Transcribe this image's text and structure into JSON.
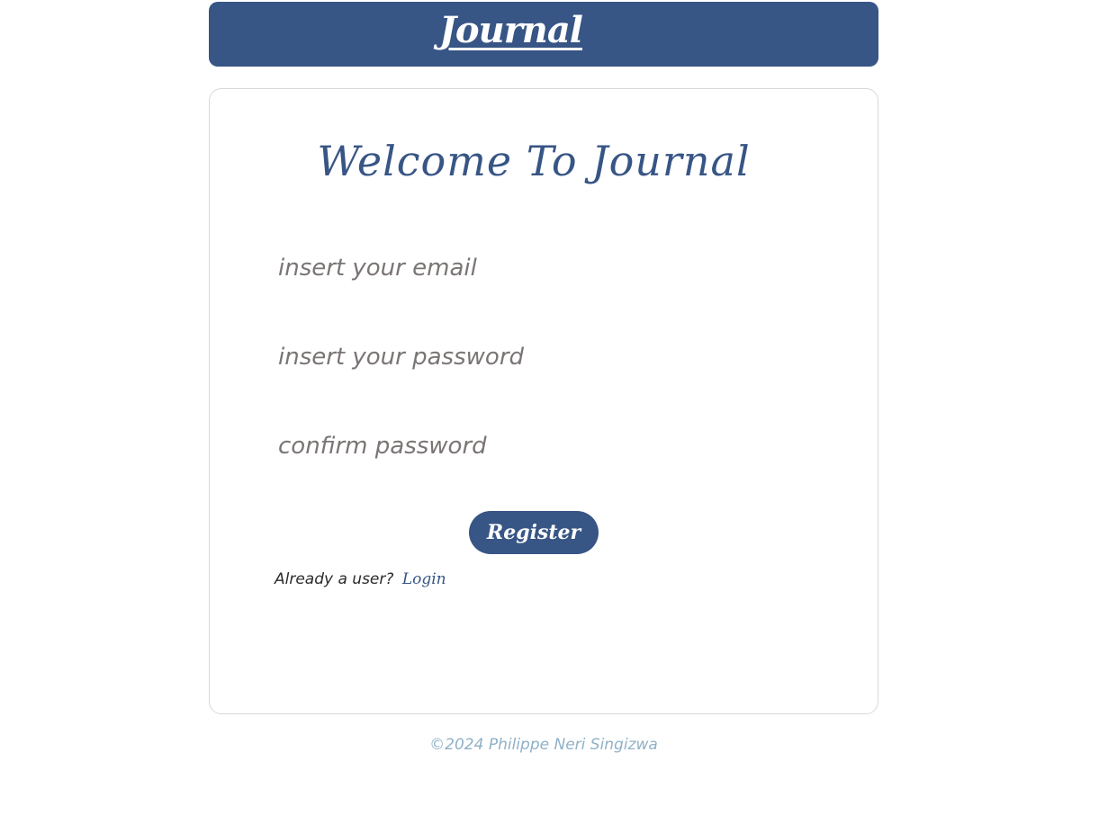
{
  "header": {
    "brand": "Journal"
  },
  "form": {
    "title": "Welcome To Journal",
    "email_placeholder": "insert your email",
    "password_placeholder": "insert your password",
    "confirm_placeholder": "confirm password",
    "register_label": "Register",
    "already_text": "Already a user?",
    "login_label": "Login"
  },
  "footer": {
    "copyright": "©2024 Philippe Neri Singizwa"
  },
  "colors": {
    "brand": "#375585",
    "footer_text": "#8fb1c7",
    "card_border": "#d8d8d8"
  }
}
